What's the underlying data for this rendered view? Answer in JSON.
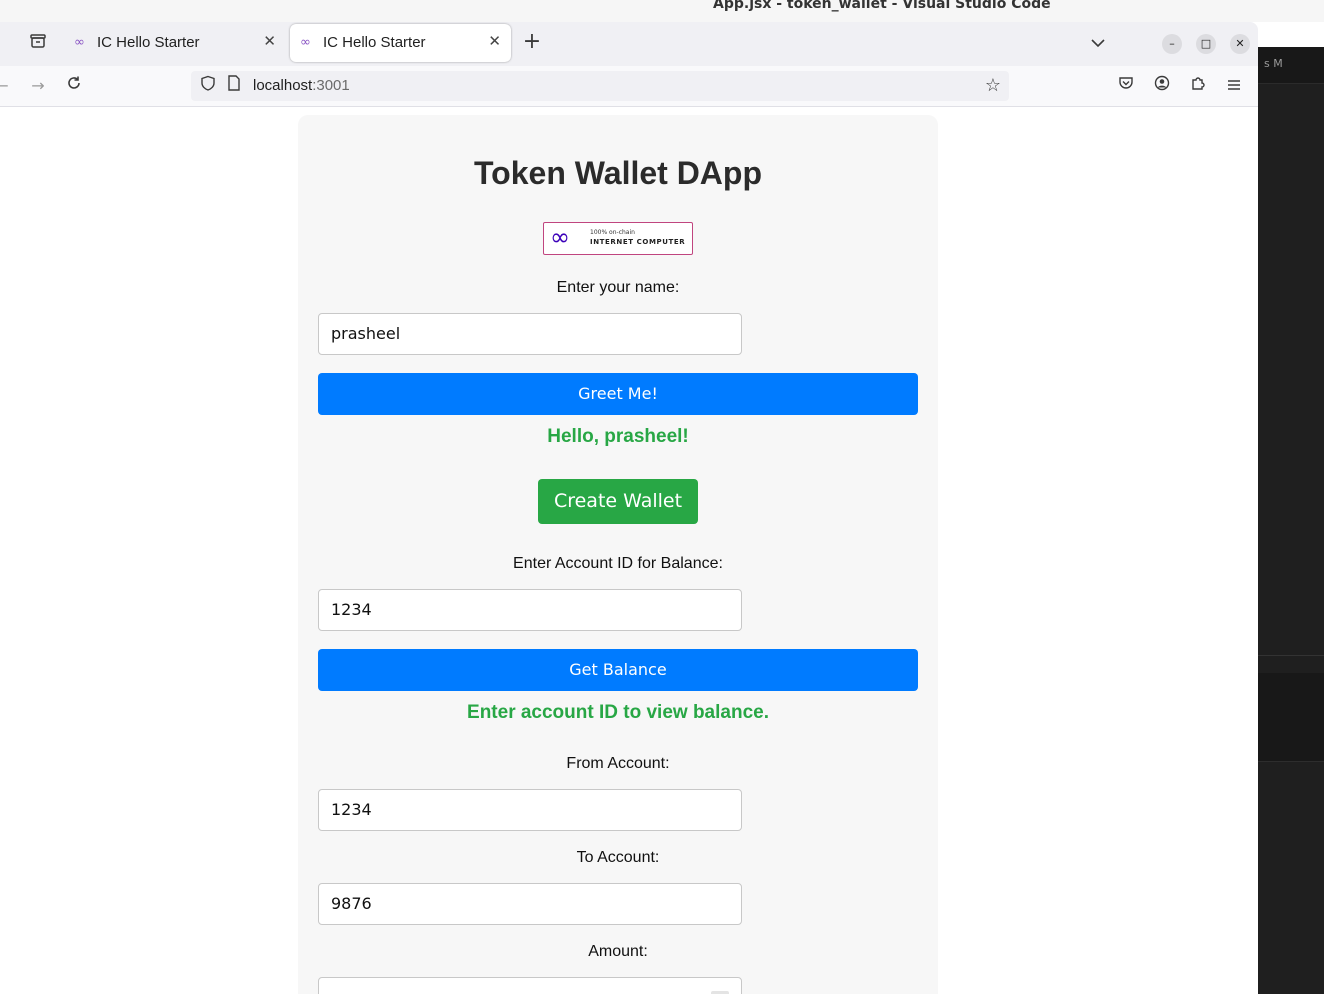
{
  "os": {
    "window_title": "App.jsx - token_wallet - Visual Studio Code"
  },
  "vscode": {
    "tab_partial": "s M"
  },
  "browser": {
    "tabs": [
      {
        "title": "IC Hello Starter",
        "active": false
      },
      {
        "title": "IC Hello Starter",
        "active": true
      }
    ],
    "new_tab": "+",
    "list_tabs": "⌄",
    "url_host": "localhost",
    "url_port": ":3001"
  },
  "page": {
    "title": "Token Wallet DApp",
    "logo": {
      "line1": "100% on-chain",
      "line2": "INTERNET COMPUTER"
    },
    "name_label": "Enter your name:",
    "name_value": "prasheel",
    "greet_button": "Greet Me!",
    "greeting": "Hello, prasheel!",
    "create_wallet_button": "Create Wallet",
    "balance_label": "Enter Account ID for Balance:",
    "balance_value": "1234",
    "balance_button": "Get Balance",
    "balance_message": "Enter account ID to view balance.",
    "from_label": "From Account:",
    "from_value": "1234",
    "to_label": "To Account:",
    "to_value": "9876",
    "amount_label": "Amount:"
  },
  "colors": {
    "primary_button": "#007bff",
    "success": "#28a745",
    "card_bg": "#f7f7f7"
  }
}
